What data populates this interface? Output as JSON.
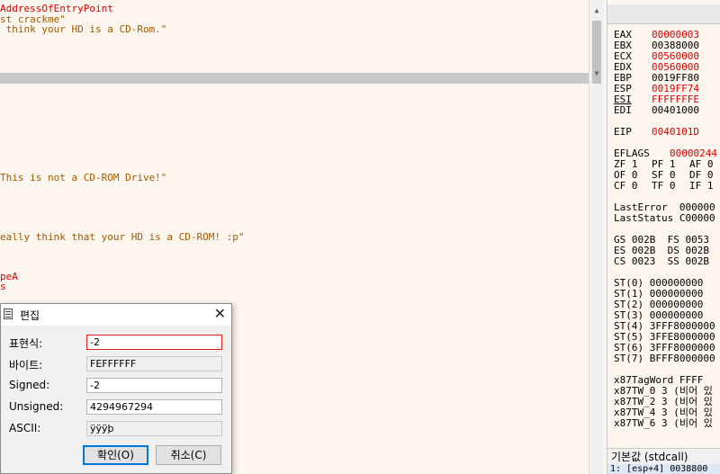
{
  "disassembly": {
    "lines": [
      {
        "text": "AddressOfEntryPoint",
        "color": "red"
      },
      {
        "text": "st crackme\"",
        "color": "brown"
      },
      {
        "text": " think your HD is a CD-Rom.\"",
        "color": "brown"
      },
      {
        "text": "This is not a CD-ROM Drive!\"",
        "color": "brown"
      },
      {
        "text": "eally think that your HD is a CD-ROM! :p\"",
        "color": "brown"
      },
      {
        "text": "peA",
        "color": "red"
      },
      {
        "text": "s",
        "color": "red"
      }
    ]
  },
  "registers": {
    "items": [
      {
        "name": "EAX",
        "value": "00000003",
        "changed": true
      },
      {
        "name": "EBX",
        "value": "00388000",
        "changed": false
      },
      {
        "name": "ECX",
        "value": "00560000",
        "changed": true
      },
      {
        "name": "EDX",
        "value": "00560000",
        "changed": true
      },
      {
        "name": "EBP",
        "value": "0019FF80",
        "changed": false
      },
      {
        "name": "ESP",
        "value": "0019FF74",
        "changed": true
      },
      {
        "name": "ESI",
        "value": "FFFFFFFE",
        "changed": true
      },
      {
        "name": "EDI",
        "value": "00401000",
        "changed": false
      }
    ],
    "eip": {
      "name": "EIP",
      "value": "0040101D"
    },
    "eflags": {
      "name": "EFLAGS",
      "value": "00000244"
    },
    "flags_rows": [
      [
        "ZF 1",
        "PF 1",
        "AF 0"
      ],
      [
        "OF 0",
        "SF 0",
        "DF 0"
      ],
      [
        "CF 0",
        "TF 0",
        "IF 1"
      ]
    ],
    "last_error": "LastError  000000",
    "last_status": "LastStatus C00000",
    "segments": [
      "GS 002B  FS 0053",
      "ES 002B  DS 002B",
      "CS 0023  SS 002B"
    ],
    "fpu": [
      "ST(0) 000000000",
      "ST(1) 000000000",
      "ST(2) 000000000",
      "ST(3) 000000000",
      "ST(4) 3FFF8000000",
      "ST(5) 3FFE8000000",
      "ST(6) 3FFF8000000",
      "ST(7) BFFF8000000"
    ],
    "x87": [
      "x87TagWord FFFF",
      "x87TW_0 3 (비어 있",
      "x87TW_2 3 (비어 있",
      "x87TW_4 3 (비어 있",
      "x87TW_6 3 (비어 있"
    ],
    "call_convention": "기본값 (stdcall)",
    "stack_row": "1: [esp+4] 0038800"
  },
  "dialog": {
    "title": "편집",
    "fields": {
      "expression": {
        "label": "표현식:",
        "value": "-2"
      },
      "bytes": {
        "label": "바이트:",
        "value": "FEFFFFFF"
      },
      "signed": {
        "label": "Signed:",
        "value": "-2"
      },
      "unsigned": {
        "label": "Unsigned:",
        "value": "4294967294"
      },
      "ascii": {
        "label": "ASCII:",
        "value": "ÿÿÿþ"
      }
    },
    "ok_label": "확인(O)",
    "cancel_label": "취소(C)",
    "close_glyph": "✕"
  },
  "scrollbar": {
    "up": "▲",
    "down": "▼"
  },
  "colors": {
    "changed": "#e00000",
    "string": "#a05a00",
    "accent": "#0078d7"
  }
}
